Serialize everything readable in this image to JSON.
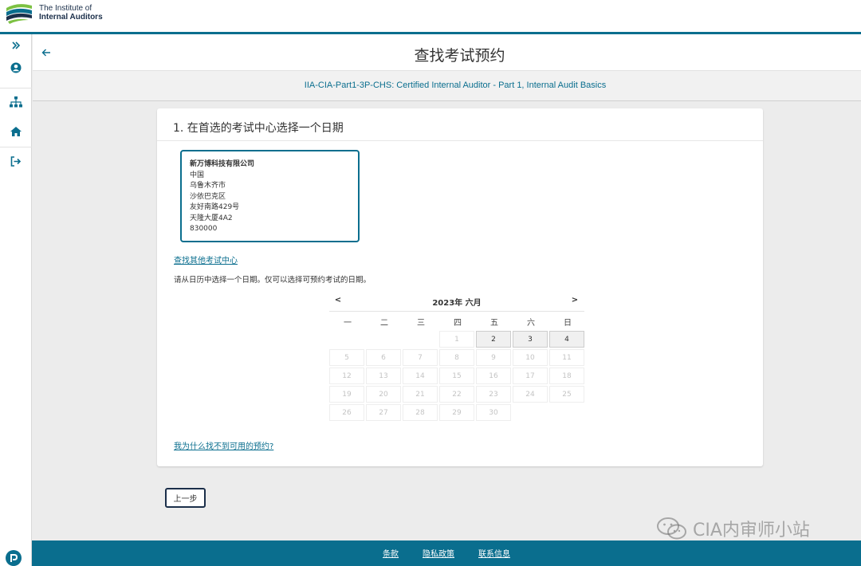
{
  "brand": {
    "line1": "The Institute of",
    "line2": "Internal Auditors",
    "colors": {
      "accent": "#0a6e8e",
      "navy": "#1b2f4a",
      "green": "#7cc142"
    }
  },
  "sidebar": {
    "items": [
      {
        "icon": "double-chevron-right-icon"
      },
      {
        "icon": "user-circle-icon"
      },
      {
        "icon": "sitemap-icon"
      },
      {
        "icon": "home-icon"
      },
      {
        "icon": "sign-out-icon"
      }
    ],
    "bottom_logo": "pearson-logo-icon"
  },
  "header": {
    "title": "查找考试预约",
    "back_icon": "arrow-left-icon",
    "exam": "IIA-CIA-Part1-3P-CHS: Certified Internal Auditor - Part 1, Internal Audit Basics"
  },
  "card": {
    "step_title": "1. 在首选的考试中心选择一个日期",
    "center": {
      "name": "新万博科技有限公司",
      "country": "中国",
      "city": "乌鲁木齐市",
      "district": "沙依巴克区",
      "street": "友好南路429号",
      "building": "天隆大厦4A2",
      "postcode": "830000"
    },
    "find_other_link": "查找其他考试中心",
    "instructions": "请从日历中选择一个日期。仅可以选择可预约考试的日期。",
    "why_link": "我为什么找不到可用的预约?"
  },
  "calendar": {
    "prev": "<",
    "next": ">",
    "month_label": "2023年 六月",
    "weekdays": [
      "一",
      "二",
      "三",
      "四",
      "五",
      "六",
      "日"
    ],
    "leading_blanks": 3,
    "days": [
      1,
      2,
      3,
      4,
      5,
      6,
      7,
      8,
      9,
      10,
      11,
      12,
      13,
      14,
      15,
      16,
      17,
      18,
      19,
      20,
      21,
      22,
      23,
      24,
      25,
      26,
      27,
      28,
      29,
      30
    ],
    "available": [
      2,
      3,
      4
    ]
  },
  "buttons": {
    "previous": "上一步"
  },
  "footer": {
    "links": [
      "条款",
      "隐私政策",
      "联系信息"
    ]
  },
  "watermark": {
    "text": "CIA内审师小站",
    "icon": "wechat-icon"
  }
}
